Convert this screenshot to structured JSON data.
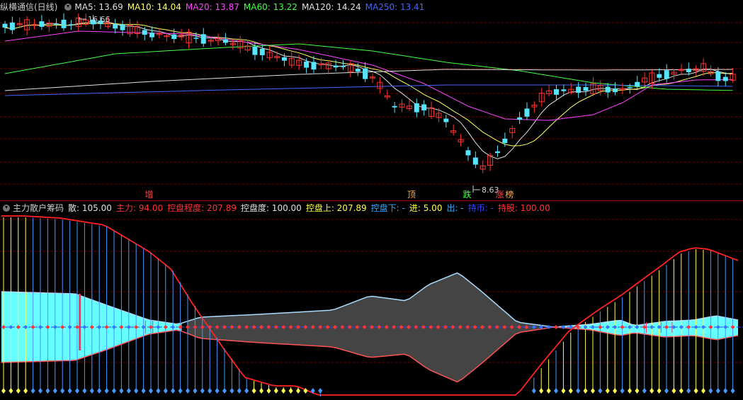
{
  "header": {
    "title": "纵横通信(日线)",
    "title_color": "#cccccc",
    "ma": [
      {
        "label": "MA5: 13.69",
        "color": "#e0e0e0"
      },
      {
        "label": "MA10: 14.04",
        "color": "#ffff66"
      },
      {
        "label": "MA20: 13.87",
        "color": "#ff44ff"
      },
      {
        "label": "MA60: 13.22",
        "color": "#44ff44"
      },
      {
        "label": "MA120: 14.24",
        "color": "#e0e0e0"
      },
      {
        "label": "MA250: 13.41",
        "color": "#4466ff"
      }
    ]
  },
  "price_annotations": {
    "high": "16.66",
    "low": "8.63"
  },
  "markers": [
    {
      "text": "增",
      "color": "#ff4444",
      "xfrac": 0.195
    },
    {
      "text": "顶",
      "color": "#ffaa44",
      "xfrac": 0.548
    },
    {
      "text": "跌",
      "color": "#44ff44",
      "xfrac": 0.623
    },
    {
      "text": "涨",
      "color": "#ff4444",
      "xfrac": 0.667
    },
    {
      "text": "榜",
      "color": "#ffaa44",
      "xfrac": 0.68
    }
  ],
  "indicator": {
    "name": "主力散户筹码",
    "name_color": "#cccccc",
    "fields": [
      {
        "label": "散: 105.00",
        "color": "#e0e0e0"
      },
      {
        "label": "主力: 94.00",
        "color": "#ff3333"
      },
      {
        "label": "控盘程度: 207.89",
        "color": "#ff3333"
      },
      {
        "label": "控盘度: 100.00",
        "color": "#e0e0e0"
      },
      {
        "label": "控盘上: 207.89",
        "color": "#ffff44"
      },
      {
        "label": "控盘下: -",
        "color": "#33aaff"
      },
      {
        "label": "进: 5.00",
        "color": "#ffff44"
      },
      {
        "label": "出: -",
        "color": "#33aaff"
      },
      {
        "label": "持币: -",
        "color": "#3344ff"
      },
      {
        "label": "持股: 100.00",
        "color": "#ff3333"
      }
    ]
  },
  "colors": {
    "up": "#ff3333",
    "down": "#55e5ff",
    "grid": "#6a0000",
    "bg": "#000000",
    "shade_cyan": "#66ffff",
    "shade_gray": "#444444",
    "vline_yellow": "#ffff55",
    "vline_blue": "#4499ff",
    "red_curve": "#ff2222"
  }
}
